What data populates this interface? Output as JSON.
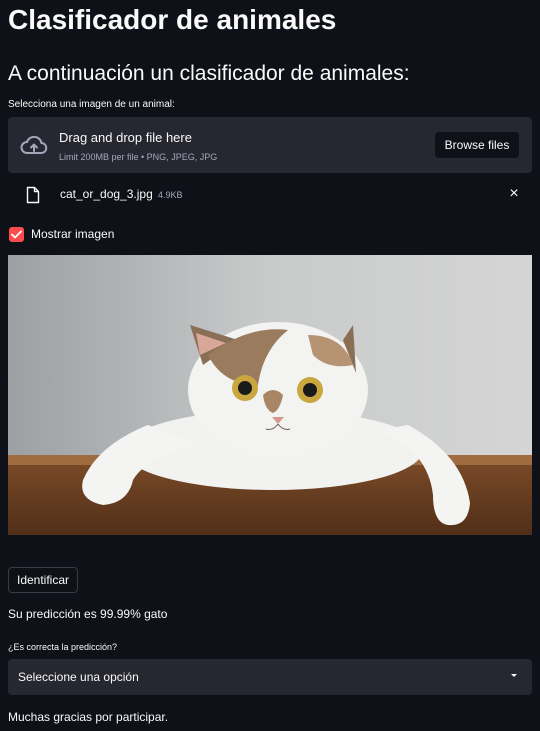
{
  "title": "Clasificador de animales",
  "subtitle": "A continuación un clasificador de animales:",
  "uploader": {
    "label": "Selecciona una imagen de un animal:",
    "drop_text": "Drag and drop file here",
    "limit_text": "Limit 200MB per file • PNG, JPEG, JPG",
    "browse_label": "Browse files",
    "file_name": "cat_or_dog_3.jpg",
    "file_size": "4.9KB",
    "close_icon": "×"
  },
  "checkbox": {
    "label": "Mostrar imagen",
    "checked": true
  },
  "identify_button": "Identificar",
  "prediction_text": "Su predicción es 99.99% gato",
  "feedback": {
    "label": "¿Es correcta la predicción?",
    "selected": "Seleccione una opción"
  },
  "thanks_text": "Muchas gracias por participar.",
  "colors": {
    "background": "#0e1117",
    "panel": "#262730",
    "accent": "#ff4b4b"
  },
  "icons": [
    "cloud-upload-icon",
    "file-icon",
    "close-icon",
    "check-icon",
    "chevron-down-icon"
  ]
}
